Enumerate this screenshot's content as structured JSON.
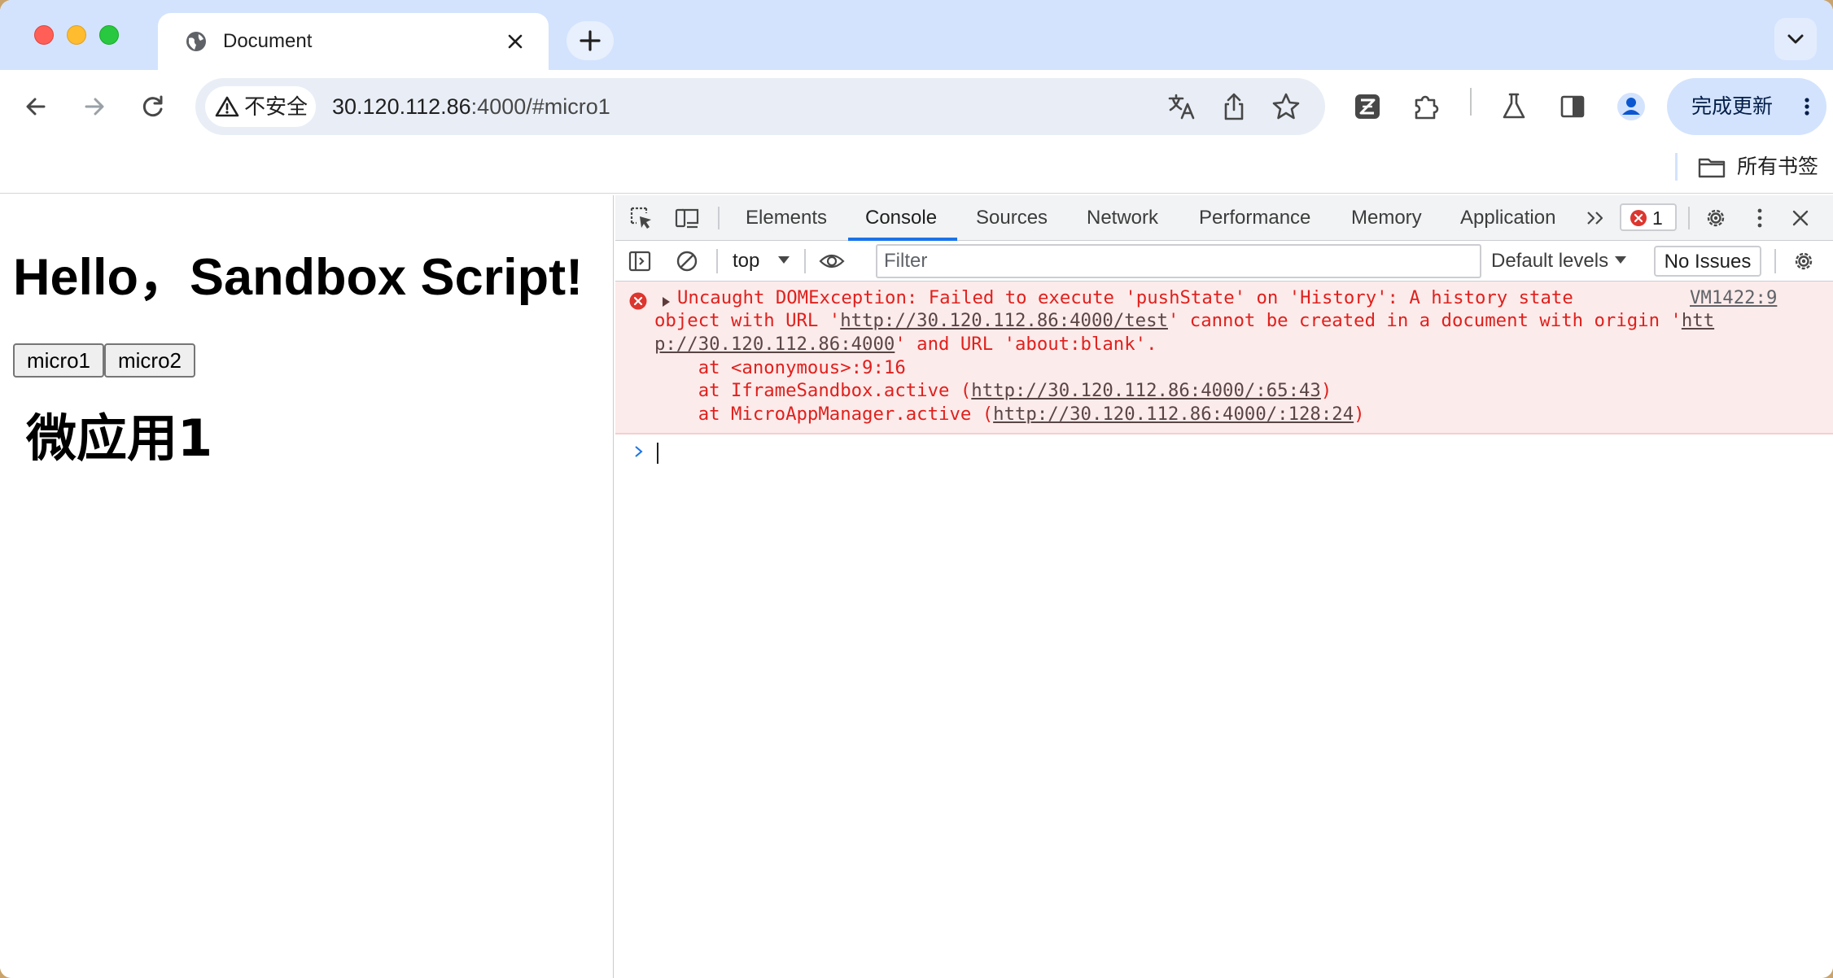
{
  "tab": {
    "title": "Document"
  },
  "address": {
    "security_label": "不安全",
    "url_host": "30.120.112.86",
    "url_rest": ":4000/#micro1"
  },
  "toolbar": {
    "update_label": "完成更新"
  },
  "bookmarks": {
    "all_bookmarks_label": "所有书签"
  },
  "page": {
    "heading": "Hello，Sandbox Script!",
    "buttons": [
      "micro1",
      "micro2"
    ],
    "subheading": "微应用1"
  },
  "devtools": {
    "tabs": [
      "Elements",
      "Console",
      "Sources",
      "Network",
      "Performance",
      "Memory",
      "Application"
    ],
    "active_tab": "Console",
    "error_count": "1",
    "context": "top",
    "filter_placeholder": "Filter",
    "levels_label": "Default levels",
    "issues_label": "No Issues",
    "console": {
      "error": {
        "source_link": "VM1422:9",
        "line1_prefix": "Uncaught DOMException: Failed to execute 'pushState' on 'History': A history state",
        "line2_prefix": "object with URL '",
        "line2_url": "http://30.120.112.86:4000/test",
        "line2_mid": "' cannot be created in a document with origin '",
        "line2_url_start": "htt",
        "line3_url_end": "p://30.120.112.86:4000",
        "line3_suffix": "' and URL 'about:blank'.",
        "stack1": "    at <anonymous>:9:16",
        "stack2_prefix": "    at IframeSandbox.active (",
        "stack2_url": "http://30.120.112.86:4000/:65:43",
        "stack2_suffix": ")",
        "stack3_prefix": "    at MicroAppManager.active (",
        "stack3_url": "http://30.120.112.86:4000/:128:24",
        "stack3_suffix": ")"
      }
    }
  },
  "colors": {
    "tabstrip_bg": "#d3e3fd",
    "omnibox_bg": "#e9eef6",
    "active_tab_underline": "#1a73e8",
    "error_text": "#e0201c",
    "error_bg": "#fcebeb"
  },
  "icons": {
    "tab_favicon": "globe-icon",
    "tab_close": "close-icon",
    "new_tab": "plus-icon",
    "tab_search": "chevron-down-icon",
    "back": "back-arrow-icon",
    "forward": "forward-arrow-icon",
    "reload": "reload-icon",
    "security": "warning-triangle-icon",
    "translate": "translate-icon",
    "share": "share-icon",
    "bookmark_star": "star-icon",
    "extension_1": "zotero-extension-icon",
    "extensions": "puzzle-icon",
    "labs": "flask-icon",
    "side_panel": "side-panel-icon",
    "profile": "profile-avatar-icon",
    "menu": "kebab-menu-icon",
    "folder": "folder-icon"
  }
}
